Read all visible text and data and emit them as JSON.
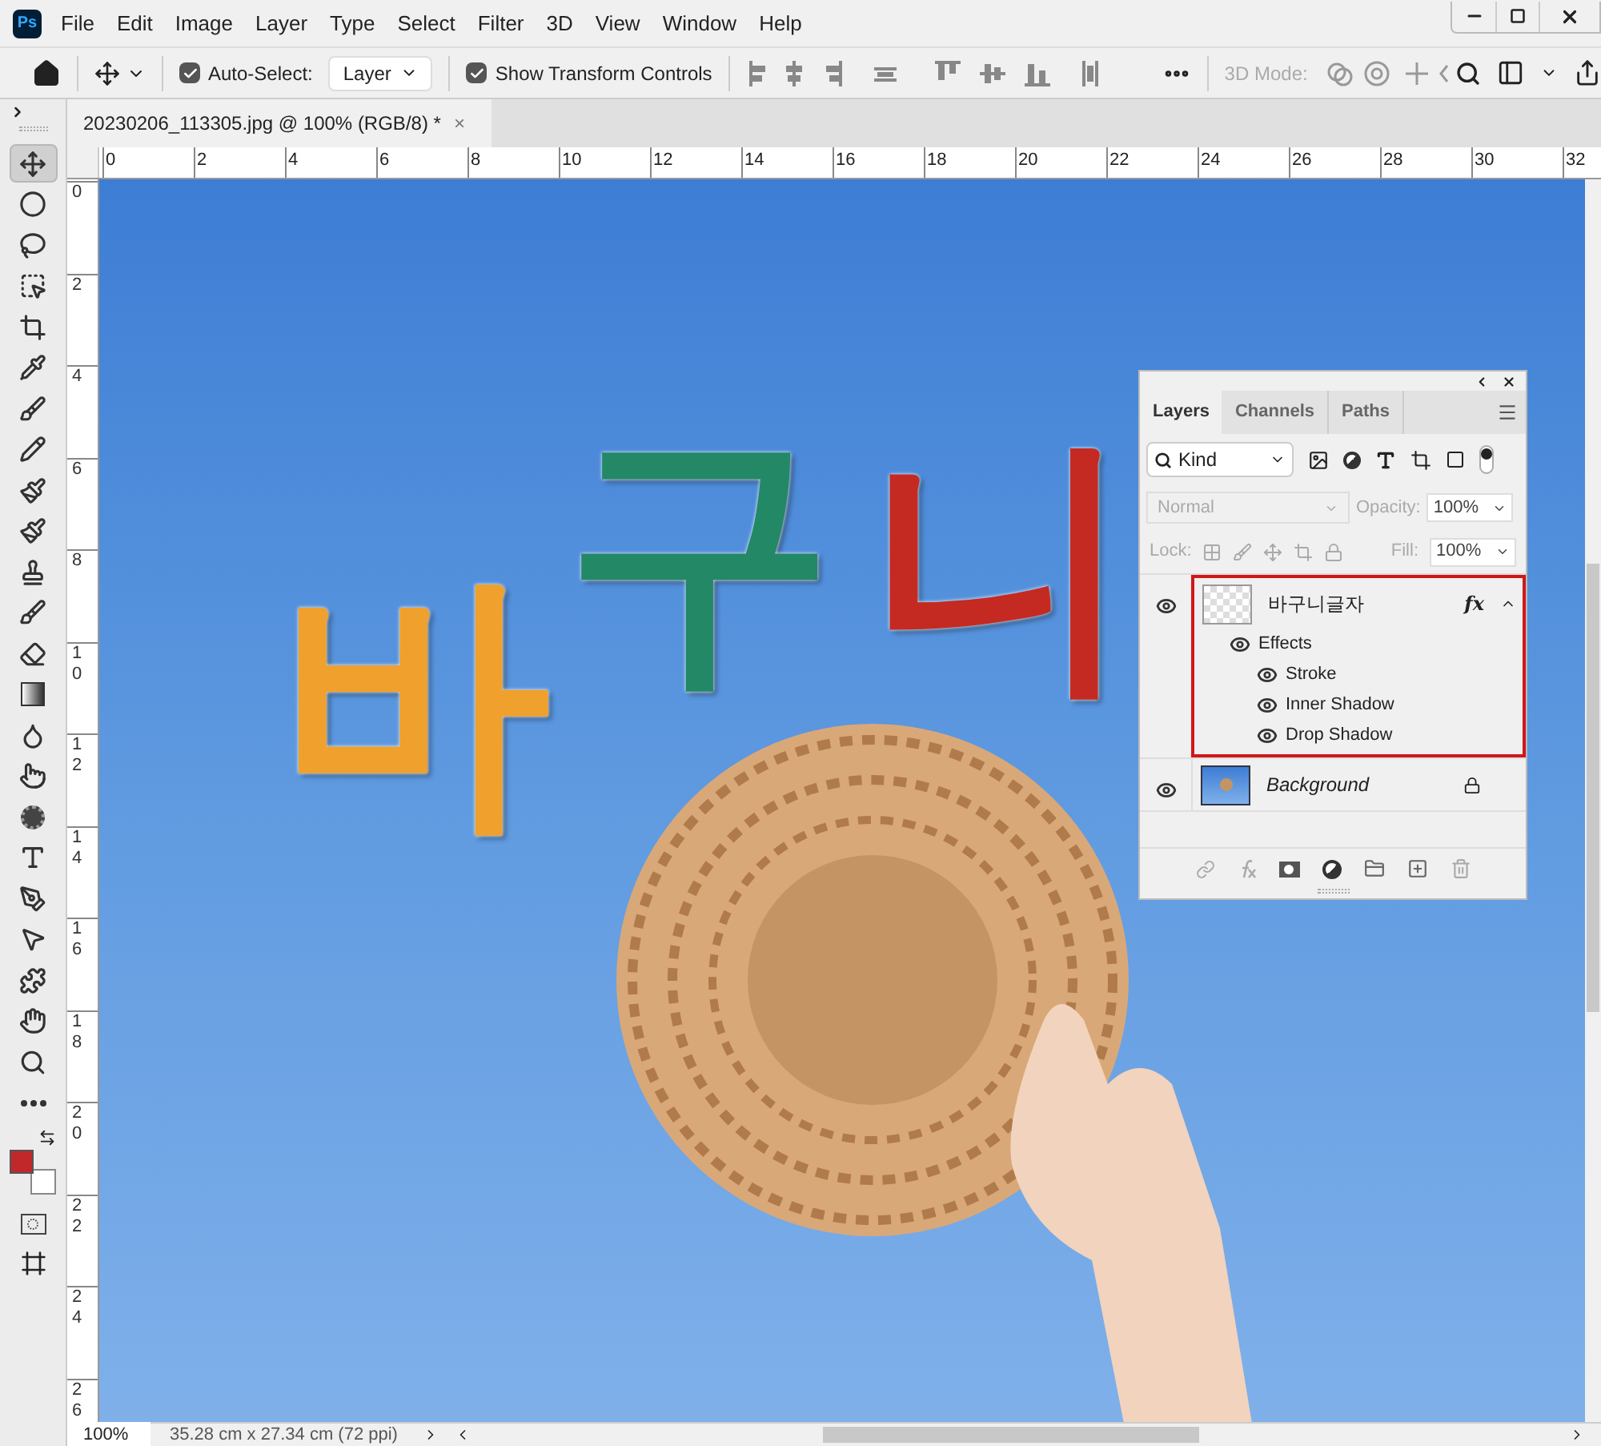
{
  "app_icon": "Ps",
  "menu": [
    "File",
    "Edit",
    "Image",
    "Layer",
    "Type",
    "Select",
    "Filter",
    "3D",
    "View",
    "Window",
    "Help"
  ],
  "options_bar": {
    "auto_select": {
      "label": "Auto-Select:",
      "checked": true
    },
    "target": "Layer",
    "show_transform": {
      "label": "Show Transform Controls",
      "checked": true
    },
    "mode_label": "3D Mode:"
  },
  "document_tab": {
    "title": "20230206_113305.jpg @ 100% (RGB/8) *",
    "close": "×"
  },
  "ruler_h": [
    "0",
    "2",
    "4",
    "6",
    "8",
    "10",
    "12",
    "14",
    "16",
    "18",
    "20",
    "22",
    "24",
    "26",
    "28",
    "30",
    "32"
  ],
  "ruler_v": [
    "0",
    "2",
    "4",
    "6",
    "8",
    "10",
    "12",
    "14",
    "16",
    "18",
    "20",
    "22",
    "24",
    "26"
  ],
  "tools": [
    {
      "kind": "move",
      "selected": true
    },
    {
      "kind": "marquee",
      "selected": false
    },
    {
      "kind": "lasso",
      "selected": false
    },
    {
      "kind": "object",
      "selected": false
    },
    {
      "kind": "crop",
      "selected": false
    },
    {
      "kind": "eyedropper",
      "selected": false
    },
    {
      "kind": "brush",
      "selected": false
    },
    {
      "kind": "pencil",
      "selected": false
    },
    {
      "kind": "replace",
      "selected": false
    },
    {
      "kind": "mixer",
      "selected": false
    },
    {
      "kind": "stamp",
      "selected": false
    },
    {
      "kind": "history",
      "selected": false
    },
    {
      "kind": "eraser",
      "selected": false
    },
    {
      "kind": "gradient",
      "selected": false
    },
    {
      "kind": "blur",
      "selected": false
    },
    {
      "kind": "smudge",
      "selected": false
    },
    {
      "kind": "sponge",
      "selected": false
    },
    {
      "kind": "type",
      "selected": false
    },
    {
      "kind": "pen",
      "selected": false
    },
    {
      "kind": "path",
      "selected": false
    },
    {
      "kind": "shape",
      "selected": false
    },
    {
      "kind": "hand",
      "selected": false
    },
    {
      "kind": "zoom",
      "selected": false
    },
    {
      "kind": "more",
      "selected": false
    }
  ],
  "colors": {
    "foreground": {
      "color": "#c0282a"
    },
    "background": {
      "color": "#ffffff"
    }
  },
  "canvas": {
    "letters": [
      {
        "text": "바",
        "color": "#f0a02c"
      },
      {
        "text": "구",
        "color": "#228866"
      },
      {
        "text": "니",
        "color": "#c42a22"
      }
    ]
  },
  "layers_panel": {
    "tabs": [
      {
        "label": "Layers",
        "selected": true
      },
      {
        "label": "Channels",
        "selected": false
      },
      {
        "label": "Paths",
        "selected": false
      }
    ],
    "filter": "Kind",
    "blend_mode": "Normal",
    "opacity_label": "Opacity:",
    "opacity": "100%",
    "lock_label": "Lock:",
    "fill_label": "Fill:",
    "fill": "100%",
    "layers": [
      {
        "name": "바구니글자",
        "kind": "text",
        "visible": true,
        "locked": false,
        "highlighted": true,
        "fx": "fx",
        "effects_label": "Effects",
        "effects": [
          {
            "name": "Stroke",
            "visible": true
          },
          {
            "name": "Inner Shadow",
            "visible": true
          },
          {
            "name": "Drop Shadow",
            "visible": true
          }
        ]
      },
      {
        "name": "Background",
        "kind": "image",
        "visible": true,
        "locked": true,
        "highlighted": false
      }
    ]
  },
  "status_bar": {
    "zoom": "100%",
    "info": "35.28 cm x 27.34 cm (72 ppi)"
  }
}
